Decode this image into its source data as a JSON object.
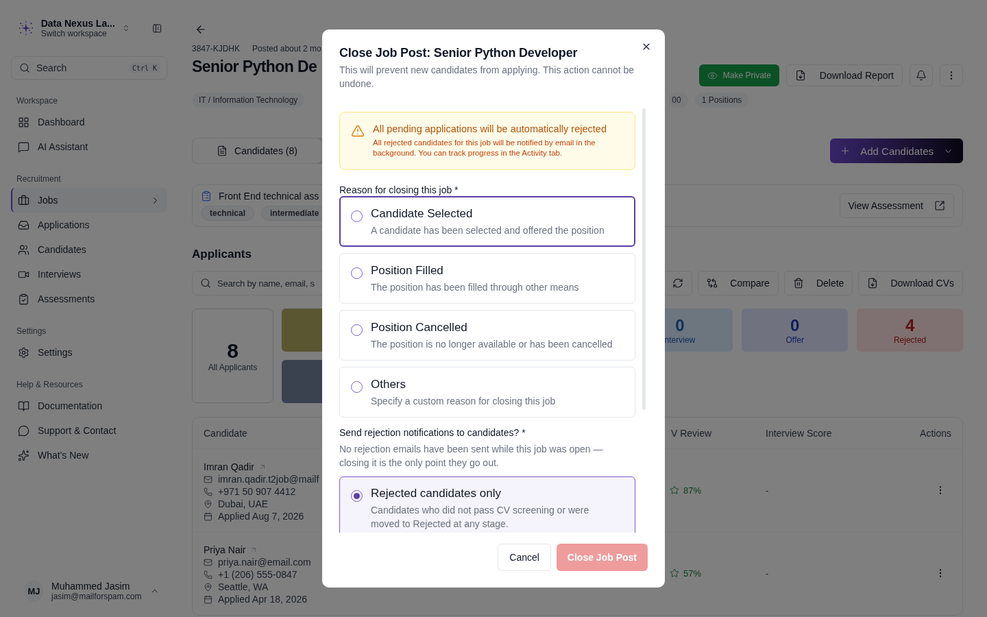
{
  "sidebar": {
    "workspace": {
      "name": "Data Nexus La...",
      "subtitle": "Switch workspace"
    },
    "search": {
      "placeholder": "Search",
      "shortcut": "Ctrl K"
    },
    "sections": [
      {
        "title": "Workspace",
        "items": [
          {
            "label": "Dashboard",
            "selected": false
          },
          {
            "label": "AI Assistant",
            "selected": false
          }
        ]
      },
      {
        "title": "Recruitment",
        "items": [
          {
            "label": "Jobs",
            "selected": true
          },
          {
            "label": "Applications",
            "selected": false
          },
          {
            "label": "Candidates",
            "selected": false
          },
          {
            "label": "Interviews",
            "selected": false
          },
          {
            "label": "Assessments",
            "selected": false
          }
        ]
      },
      {
        "title": "Settings",
        "items": [
          {
            "label": "Settings",
            "selected": false
          }
        ]
      },
      {
        "title": "Help & Resources",
        "items": [
          {
            "label": "Documentation",
            "selected": false
          },
          {
            "label": "Support & Contact",
            "selected": false
          },
          {
            "label": "What's New",
            "selected": false
          }
        ]
      }
    ],
    "user": {
      "initials": "MJ",
      "name": "Muhammed Jasim",
      "email": "jasim@mailforspam.com"
    }
  },
  "job": {
    "code": "3847-KJDHK",
    "posted": "Posted about 2 mo",
    "title": "Senior Python De",
    "tags": [
      "IT / Information Technology",
      "00",
      "1 Positions"
    ],
    "actions": {
      "make_private": "Make Private",
      "download_report": "Download Report"
    }
  },
  "tabs": [
    {
      "label": "Candidates (8)",
      "selected": true
    }
  ],
  "add_candidates": "Add Candidates",
  "assessment": {
    "title": "Front End technical ass",
    "tags": [
      "technical",
      "intermediate"
    ],
    "action": "View Assessment"
  },
  "applicants": {
    "heading": "Applicants",
    "search_placeholder": "Search by name, email, s",
    "toolbar": [
      "Compare",
      "Delete",
      "Download CVs"
    ],
    "total": {
      "value": "8",
      "label": "All Applicants"
    },
    "stage_cards_left": [
      {
        "color": "#5a5632"
      },
      {
        "color": "#3a4250"
      }
    ],
    "stage_cards_right": [
      {
        "value": "0",
        "label": "nterview",
        "color": "#6d757f"
      },
      {
        "value": "0",
        "label": "Offer",
        "color": "#70737f"
      },
      {
        "value": "4",
        "label": "Rejected",
        "color": "#7f7171"
      }
    ],
    "table": {
      "columns": [
        "Candidate",
        "V Review",
        "Interview Score",
        "Actions"
      ],
      "rows": [
        {
          "name": "Imran Qadir",
          "email": "imran.qadir.t2job@mailf",
          "phone": "+971 50 907 4412",
          "location": "Dubai, UAE",
          "applied": "Applied Aug 7, 2026",
          "cv_score": "87%",
          "interview_score": "-"
        },
        {
          "name": "Priya Nair",
          "email": "priya.nair@email.com",
          "phone": "+1 (206) 555-0847",
          "location": "Seattle, WA",
          "applied": "Applied Apr 18, 2026",
          "cv_score": "57%",
          "interview_score": "-"
        }
      ]
    }
  },
  "dialog": {
    "title": "Close Job Post: Senior Python Developer",
    "description": "This will prevent new candidates from applying. This action cannot be undone.",
    "warning": {
      "title": "All pending applications will be automatically rejected",
      "body": "All rejected candidates for this job will be notified by email in the background. You can track progress in the Activity tab."
    },
    "reason_label": "Reason for closing this job *",
    "reasons": [
      {
        "title": "Candidate Selected",
        "description": "A candidate has been selected and offered the position",
        "selected": false,
        "focused": true
      },
      {
        "title": "Position Filled",
        "description": "The position has been filled through other means",
        "selected": false,
        "focused": false
      },
      {
        "title": "Position Cancelled",
        "description": "The position is no longer available or has been cancelled",
        "selected": false,
        "focused": false
      },
      {
        "title": "Others",
        "description": "Specify a custom reason for closing this job",
        "selected": false,
        "focused": false
      }
    ],
    "notify_label": "Send rejection notifications to candidates? *",
    "notify_note": "No rejection emails have been sent while this job was open — closing it is the only point they go out.",
    "notify_options": [
      {
        "title": "Rejected candidates only",
        "description": "Candidates who did not pass CV screening or were moved to Rejected at any stage.",
        "selected": true
      }
    ],
    "cancel": "Cancel",
    "confirm": {
      "label": "Close Job Post",
      "disabled": true
    }
  }
}
